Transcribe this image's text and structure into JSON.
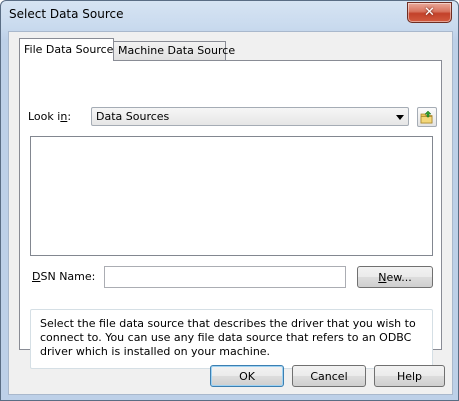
{
  "window": {
    "title": "Select Data Source",
    "close_symbol": "✕"
  },
  "tabs": [
    {
      "label": "File Data Source",
      "active": true
    },
    {
      "label": "Machine Data Source",
      "active": false
    }
  ],
  "look_in": {
    "label_prefix": "Look i",
    "label_accel": "n",
    "label_suffix": ":",
    "value": "Data Sources"
  },
  "dsn": {
    "label_accel": "D",
    "label_rest": "SN Name:",
    "value": ""
  },
  "buttons": {
    "new_accel": "N",
    "new_rest": "ew...",
    "ok": "OK",
    "cancel": "Cancel",
    "help": "Help"
  },
  "description": "Select the file data source that describes the driver that you wish to connect to. You can use any file data source that refers to an ODBC driver which is installed on your machine.",
  "icons": {
    "close": "close-icon",
    "folder_up": "folder-up-icon",
    "dropdown": "chevron-down-icon"
  }
}
